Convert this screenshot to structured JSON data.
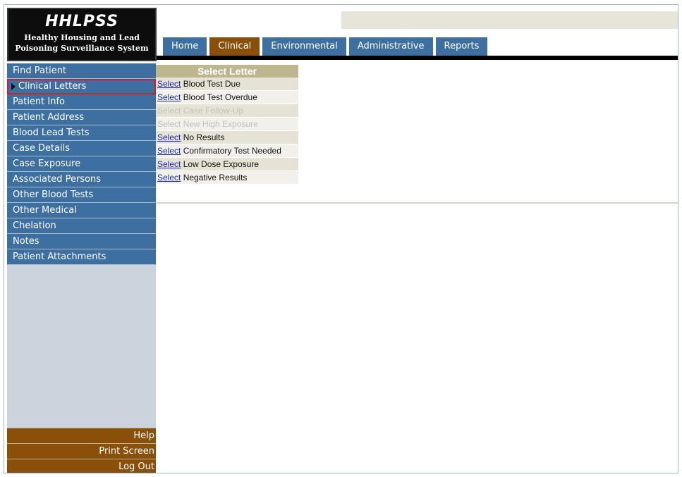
{
  "logo": {
    "title": "HHLPSS",
    "line1": "Healthy Housing and Lead",
    "line2": "Poisoning Surveillance System"
  },
  "tabs": [
    {
      "label": "Home",
      "active": false
    },
    {
      "label": "Clinical",
      "active": true
    },
    {
      "label": "Environmental",
      "active": false
    },
    {
      "label": "Administrative",
      "active": false
    },
    {
      "label": "Reports",
      "active": false
    }
  ],
  "sidebar": {
    "items": [
      {
        "label": "Find Patient"
      },
      {
        "label": "Clinical Letters",
        "selected": true
      },
      {
        "label": "Patient Info"
      },
      {
        "label": "Patient Address"
      },
      {
        "label": "Blood Lead Tests"
      },
      {
        "label": "Case Details"
      },
      {
        "label": "Case Exposure"
      },
      {
        "label": "Associated Persons"
      },
      {
        "label": "Other Blood Tests"
      },
      {
        "label": "Other Medical"
      },
      {
        "label": "Chelation"
      },
      {
        "label": "Notes"
      },
      {
        "label": "Patient Attachments"
      }
    ],
    "bottom": [
      {
        "label": "Help"
      },
      {
        "label": "Print Screen"
      },
      {
        "label": "Log Out"
      }
    ]
  },
  "letters": {
    "header": "Select Letter",
    "select_label": "Select",
    "rows": [
      {
        "name": "Blood Test Due",
        "enabled": true
      },
      {
        "name": "Blood Test Overdue",
        "enabled": true
      },
      {
        "name": "Case Follow-Up",
        "enabled": false
      },
      {
        "name": "New High Exposure",
        "enabled": false
      },
      {
        "name": "No Results",
        "enabled": true
      },
      {
        "name": "Confirmatory Test Needed",
        "enabled": true
      },
      {
        "name": "Low Dose Exposure",
        "enabled": true
      },
      {
        "name": "Negative Results",
        "enabled": true
      }
    ]
  },
  "colors": {
    "nav_blue": "#3e6fa1",
    "active_brown": "#8a4f08",
    "selection_red": "#cf1f2c",
    "link_blue": "#1c2bb6"
  }
}
